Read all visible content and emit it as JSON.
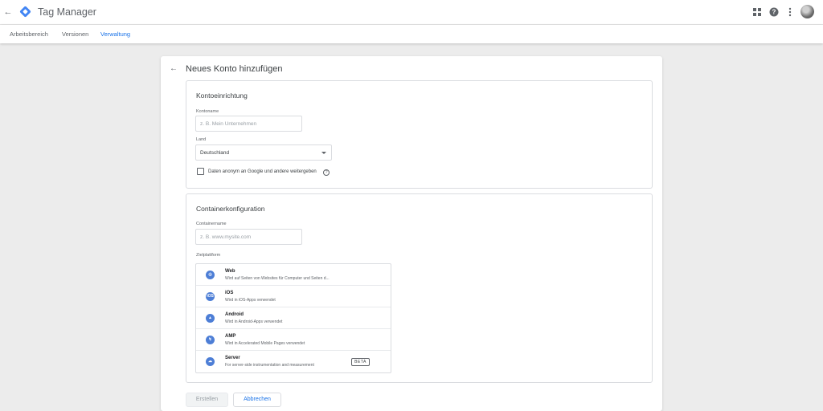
{
  "app": {
    "title": "Tag Manager",
    "brand_color": "#1a73e8"
  },
  "header": {
    "icons": [
      "back-arrow-icon",
      "apps-grid-icon",
      "help-icon",
      "more-vert-icon",
      "avatar"
    ]
  },
  "tabs": [
    {
      "label": "Arbeitsbereich",
      "active": false
    },
    {
      "label": "Versionen",
      "active": false
    },
    {
      "label": "Verwaltung",
      "active": true
    }
  ],
  "page": {
    "title": "Neues Konto hinzufügen"
  },
  "account_setup": {
    "title": "Kontoeinrichtung",
    "account_name_label": "Kontoname",
    "account_name_placeholder": "z. B. Mein Unternehmen",
    "country_label": "Land",
    "country_value": "Deutschland",
    "share_data_label": "Daten anonym an Google und andere weitergeben",
    "share_data_checked": false
  },
  "container_setup": {
    "title": "Containerkonfiguration",
    "container_name_label": "Containername",
    "container_name_placeholder": "z. B. www.mysite.com",
    "target_platform_label": "Zielplattform",
    "platforms": [
      {
        "name": "Web",
        "description": "Wird auf Seiten von Websites für Computer und Seiten d...",
        "icon": "globe-icon",
        "badge": ""
      },
      {
        "name": "iOS",
        "description": "Wird in iOS-Apps verwendet",
        "icon": "ios-icon",
        "badge": ""
      },
      {
        "name": "Android",
        "description": "Wird in Android-Apps verwendet",
        "icon": "android-icon",
        "badge": ""
      },
      {
        "name": "AMP",
        "description": "Wird in Accelerated Mobile Pages verwendet",
        "icon": "bolt-icon",
        "badge": ""
      },
      {
        "name": "Server",
        "description": "For server-side instrumentation and measurement",
        "icon": "cloud-icon",
        "badge": "BETA"
      }
    ]
  },
  "actions": {
    "create_label": "Erstellen",
    "cancel_label": "Abbrechen"
  }
}
